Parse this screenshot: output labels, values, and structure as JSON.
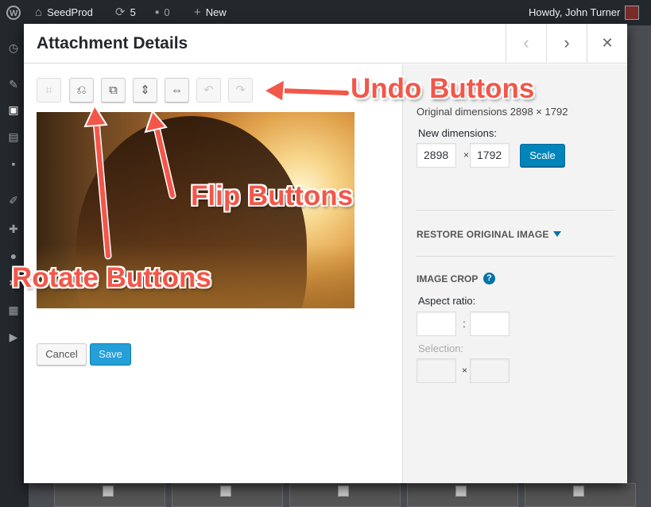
{
  "admin_bar": {
    "site_name": "SeedProd",
    "updates_count": "5",
    "comments_count": "0",
    "new_label": "New",
    "greeting": "Howdy, John Turner"
  },
  "modal": {
    "title": "Attachment Details",
    "prev_icon": "chevron-left-icon",
    "next_icon": "chevron-right-icon",
    "close_icon": "close-icon"
  },
  "toolbar": {
    "tools": [
      {
        "name": "crop",
        "icon": "crop-icon",
        "disabled": true
      },
      {
        "name": "rotate-left",
        "icon": "rotate-left-icon",
        "disabled": false
      },
      {
        "name": "rotate-right",
        "icon": "rotate-right-icon",
        "disabled": false
      },
      {
        "name": "flip-vertical",
        "icon": "flip-vertical-icon",
        "disabled": false
      },
      {
        "name": "flip-horizontal",
        "icon": "flip-horizontal-icon",
        "disabled": false
      },
      {
        "name": "undo",
        "icon": "undo-icon",
        "disabled": true
      },
      {
        "name": "redo",
        "icon": "redo-icon",
        "disabled": true
      }
    ]
  },
  "actions": {
    "cancel_label": "Cancel",
    "save_label": "Save"
  },
  "scale": {
    "original_dimensions": "Original dimensions 2898 × 1792",
    "new_dimensions_label": "New dimensions:",
    "width_value": "2898",
    "height_value": "1792",
    "separator": "×",
    "scale_label": "Scale"
  },
  "restore": {
    "label": "RESTORE ORIGINAL IMAGE"
  },
  "crop": {
    "title": "IMAGE CROP",
    "help_symbol": "?",
    "aspect_ratio_label": "Aspect ratio:",
    "aspect_separator": ":",
    "selection_label": "Selection:",
    "selection_separator": "×"
  },
  "annotations": {
    "undo": "Undo Buttons",
    "flip": "Flip Buttons",
    "rotate": "Rotate Buttons"
  },
  "colors": {
    "accent_blue": "#0085ba",
    "annotation_red": "#f2574a",
    "admin_bar": "#23282d"
  }
}
